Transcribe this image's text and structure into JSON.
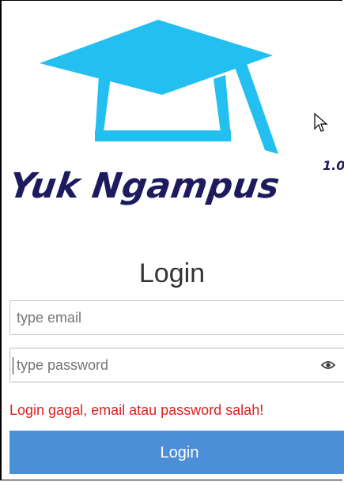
{
  "app": {
    "brand_name": "Yuk Ngampus",
    "version": "1.0",
    "logo_icon": "graduation-cap-icon",
    "logo_color": "#22bff0",
    "brand_color": "#1d1b5e"
  },
  "login": {
    "heading": "Login",
    "email": {
      "placeholder": "type email",
      "value": ""
    },
    "password": {
      "placeholder": "type password",
      "value": "",
      "toggle_icon": "eye-icon"
    },
    "error_message": "Login gagal, email atau password salah!",
    "submit_label": "Login",
    "error_color": "#e02020",
    "button_color": "#4b8fd8"
  }
}
